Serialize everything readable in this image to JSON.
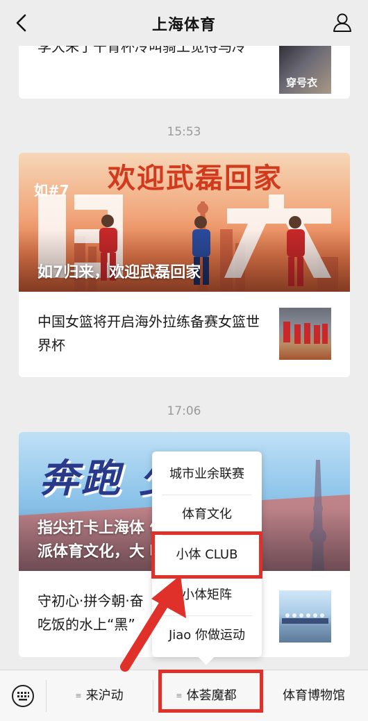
{
  "nav": {
    "title": "上海体育"
  },
  "card1": {
    "text": "李大朱了干育杯冷叫骑工觉待马冷",
    "thumb_label": "穿号衣"
  },
  "time1": "15:53",
  "card2": {
    "hero_caption": "如7归来，欢迎武磊回家",
    "hero_banner": "欢迎武磊回家",
    "hero_tag": "如#7",
    "hero_big": "归来",
    "row_text": "中国女篮将开启海外拉练备赛女篮世界杯"
  },
  "time2": "17:06",
  "card3": {
    "hero_banner": "奔跑   少年",
    "hero_caption_line1": "指尖打卡上海体        体验海",
    "hero_caption_line2": "派体育文化，大          吧",
    "row_text_line1": "守初心·拼今朝·奋",
    "row_text_line2": "吃饭的水上“黑”"
  },
  "popup": {
    "items": [
      "城市业余联赛",
      "体育文化",
      "小体 CLUB",
      "小体矩阵",
      "Jiao 你做运动"
    ]
  },
  "bottombar": {
    "tabs": [
      {
        "label": "来沪动",
        "lines": "≡"
      },
      {
        "label": "体荟魔都",
        "lines": "≡"
      },
      {
        "label": "体育博物馆"
      }
    ]
  },
  "colors": {
    "highlight": "#e0302a",
    "background": "#ededed"
  }
}
